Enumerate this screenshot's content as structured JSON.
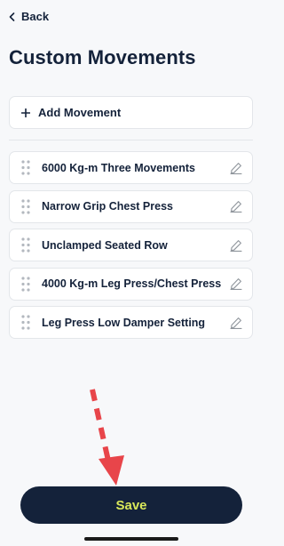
{
  "nav": {
    "back_label": "Back"
  },
  "page": {
    "title": "Custom Movements"
  },
  "actions": {
    "add_label": "Add Movement",
    "save_label": "Save"
  },
  "movements": [
    {
      "label": "6000 Kg-m Three Movements"
    },
    {
      "label": "Narrow Grip Chest Press"
    },
    {
      "label": "Unclamped Seated Row"
    },
    {
      "label": "4000 Kg-m Leg Press/Chest Press"
    },
    {
      "label": "Leg Press Low Damper Setting"
    }
  ],
  "icons": {
    "back": "chevron-left-icon",
    "add": "plus-icon",
    "grip": "drag-handle-icon",
    "edit": "pencil-icon"
  },
  "colors": {
    "primary": "#14223a",
    "save_text": "#d9e85a",
    "annotation": "#e8454a",
    "background": "#f7f8fa"
  }
}
